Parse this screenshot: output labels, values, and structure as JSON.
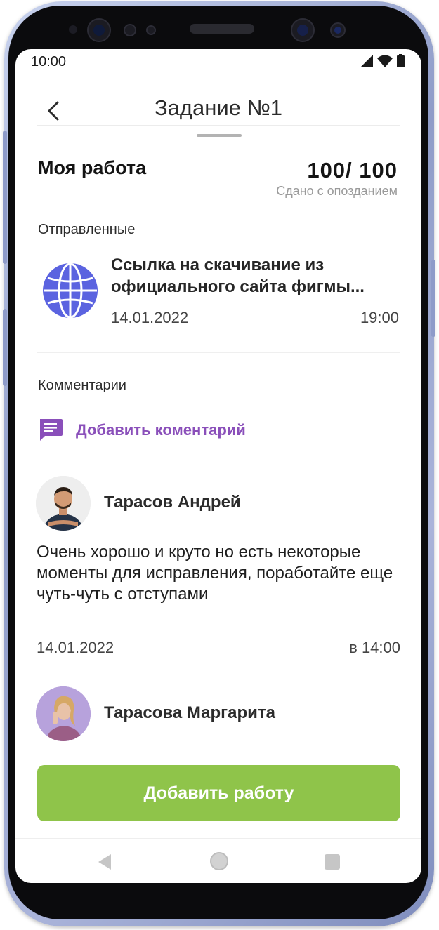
{
  "status_bar": {
    "time": "10:00",
    "icons": [
      "signal-icon",
      "wifi-icon",
      "battery-icon"
    ]
  },
  "header": {
    "title": "Задание №1",
    "back_icon": "chevron-left-icon"
  },
  "my_work": {
    "heading": "Моя работа",
    "score": "100/ 100",
    "status": "Сдано с опозданием"
  },
  "sent": {
    "heading": "Отправленные",
    "item": {
      "icon": "globe-icon",
      "title": "Ссылка на скачивание из официального сайта фигмы...",
      "date": "14.01.2022",
      "time": "19:00"
    }
  },
  "comments": {
    "heading": "Комментарии",
    "add_label": "Добавить коментарий",
    "add_icon": "comment-icon",
    "items": [
      {
        "author": "Тарасов Андрей",
        "text": "Очень хорошо и круто но есть некоторые моменты для исправления, поработайте еще чуть-чуть с отступами",
        "date": "14.01.2022",
        "time": "в 14:00"
      },
      {
        "author": "Тарасова Маргарита"
      }
    ]
  },
  "actions": {
    "add_work_label": "Добавить работу"
  },
  "nav_bar": {
    "icons": [
      "back-triangle-icon",
      "home-circle-icon",
      "recents-square-icon"
    ]
  },
  "colors": {
    "accent_purple": "#8a4fba",
    "primary_green": "#8fc44a",
    "globe_blue": "#5b63e0"
  }
}
